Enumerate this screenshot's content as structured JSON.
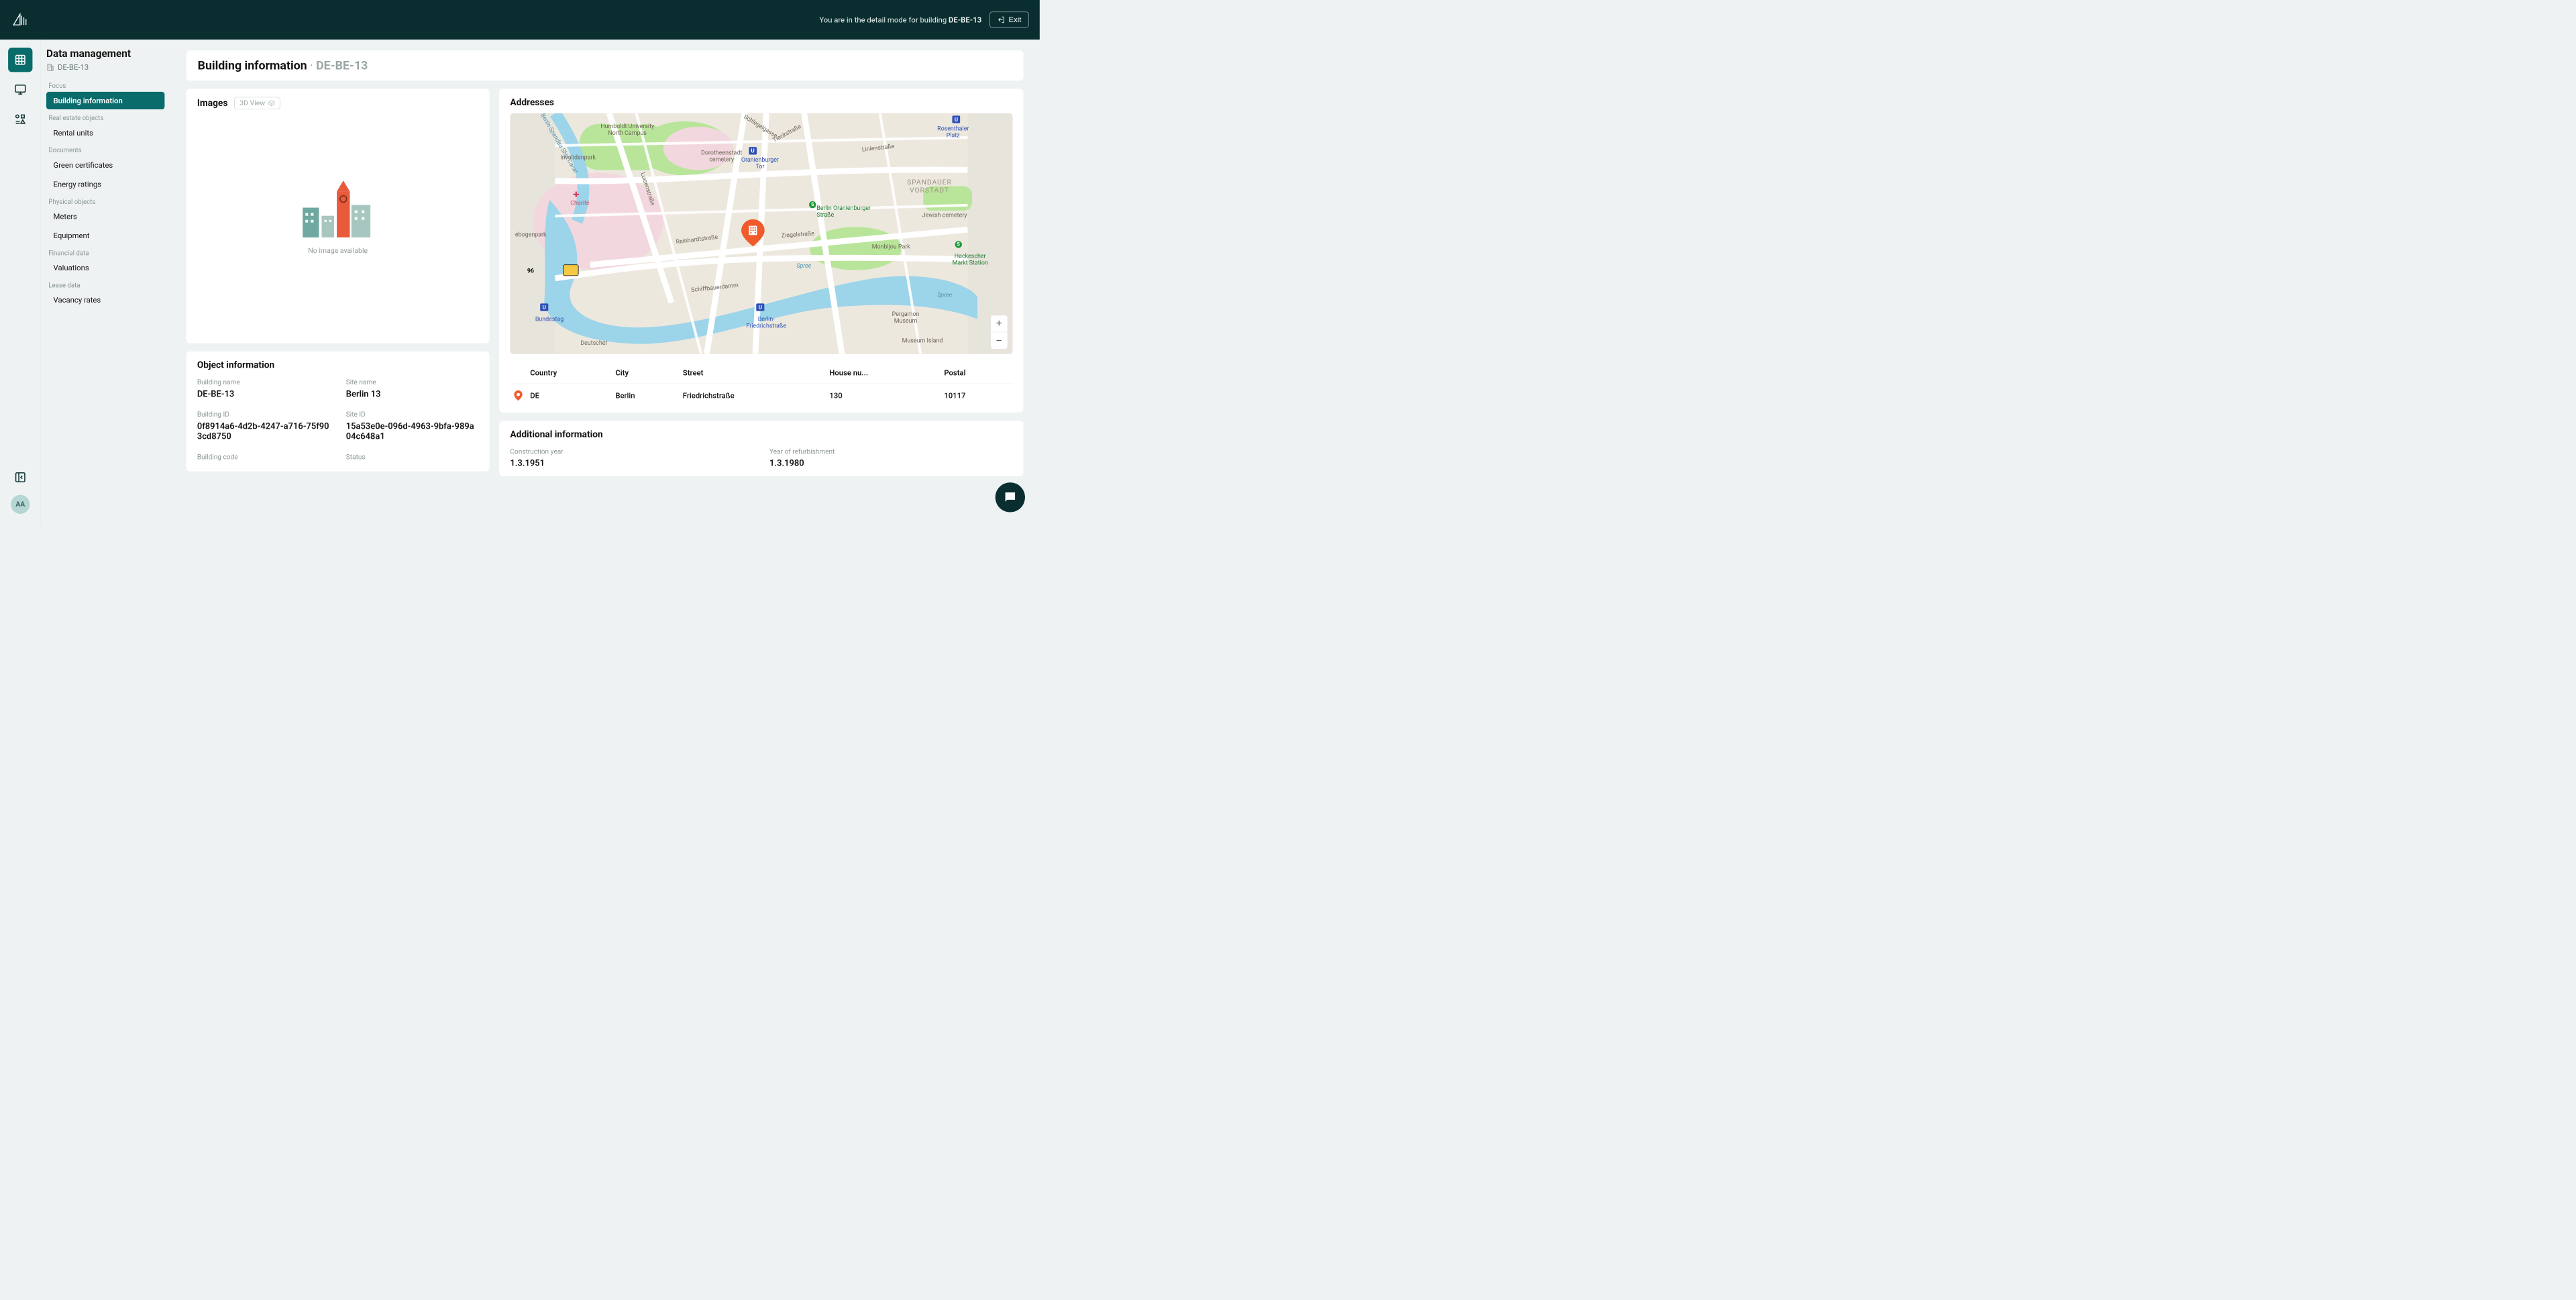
{
  "header": {
    "detail_prefix": "You are in the detail mode for building ",
    "detail_code": "DE-BE-13",
    "exit_label": "Exit"
  },
  "rail": {
    "avatar": "AA"
  },
  "sidebar": {
    "title": "Data management",
    "building_code": "DE-BE-13",
    "groups": [
      {
        "label": "Focus",
        "items": [
          "Building information"
        ]
      },
      {
        "label": "Real estate objects",
        "items": [
          "Rental units"
        ]
      },
      {
        "label": "Documents",
        "items": [
          "Green certificates",
          "Energy ratings"
        ]
      },
      {
        "label": "Physical objects",
        "items": [
          "Meters",
          "Equipment"
        ]
      },
      {
        "label": "Financial data",
        "items": [
          "Valuations"
        ]
      },
      {
        "label": "Lease data",
        "items": [
          "Vacancy rates"
        ]
      }
    ]
  },
  "page": {
    "title": "Building information",
    "title_sep": "·",
    "title_code": "DE-BE-13"
  },
  "images_card": {
    "title": "Images",
    "view3d_label": "3D View",
    "noimg": "No image available"
  },
  "object_card": {
    "title": "Object information",
    "fields": {
      "building_name_label": "Building name",
      "building_name_value": "DE-BE-13",
      "site_name_label": "Site name",
      "site_name_value": "Berlin 13",
      "building_id_label": "Building ID",
      "building_id_value": "0f8914a6-4d2b-4247-a716-75f903cd8750",
      "site_id_label": "Site ID",
      "site_id_value": "15a53e0e-096d-4963-9bfa-989a04c648a1",
      "building_code_label": "Building code",
      "status_label": "Status"
    }
  },
  "addresses_card": {
    "title": "Addresses",
    "columns": [
      "Country",
      "City",
      "Street",
      "House nu...",
      "Postal"
    ],
    "row": {
      "country": "DE",
      "city": "Berlin",
      "street": "Friedrichstraße",
      "house": "130",
      "postal": "10117"
    },
    "zoom_in": "+",
    "zoom_out": "−",
    "map_labels": {
      "humboldt": "Humboldt University\nNorth Campus",
      "invalidenpark": "Invalidenpark",
      "dorotheen": "Dorotheenstadt\ncemetery",
      "rosenthaler": "Rosenthaler\nPlatz",
      "spandauer": "SPANDAUER\nVORSTADT",
      "oranienburger": "Berlin Oranienburger\nStraße",
      "jewish": "Jewish cemetery",
      "monbijou": "Monbijou Park",
      "hackescher": "Hackescher\nMarkt Station",
      "reinhardt": "Reinhardtstraße",
      "ziegel": "Ziegelstraße",
      "charite": "Charité",
      "schiffbauer": "Schiffbauerdamm",
      "oranienburger_tor": "Oranienburger\nTor",
      "friedrich": "Berlin-\nFriedrichstraße",
      "bundestag": "Bundestag",
      "deutscher": "Deutscher",
      "ebogenpark": "ebogenpark",
      "pergamon": "Pergamon\nMuseum",
      "museum_island": "Museum Island",
      "spree": "Spree",
      "spree2": "Spree",
      "luisen": "Luisenstraße",
      "tieck": "Tieckstraße",
      "linien": "Linienstraße",
      "schlegel": "Schlegelgasse",
      "canal": "Berlin-Spandau Ship Canal",
      "hwy": "96"
    }
  },
  "additional_card": {
    "title": "Additional information",
    "construction_label": "Construction year",
    "construction_value": "1.3.1951",
    "refurb_label": "Year of refurbishment",
    "refurb_value": "1.3.1980"
  }
}
